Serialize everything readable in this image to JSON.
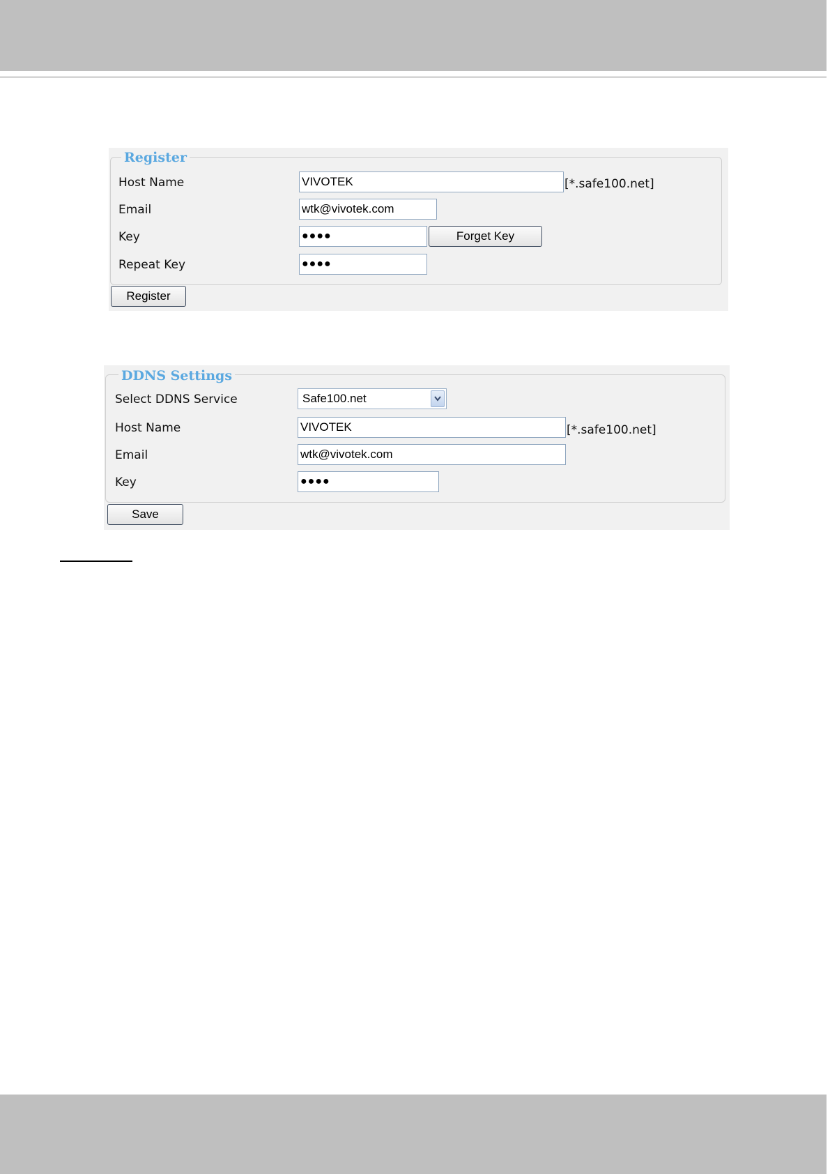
{
  "register": {
    "legend": "Register",
    "host_name_label": "Host Name",
    "host_name_value": "VIVOTEK",
    "host_suffix": "[*.safe100.net]",
    "email_label": "Email",
    "email_value": "wtk@vivotek.com",
    "key_label": "Key",
    "key_value": "●●●●",
    "forget_key_label": "Forget Key",
    "repeat_key_label": "Repeat Key",
    "repeat_key_value": "●●●●",
    "register_button": "Register"
  },
  "ddns": {
    "legend": "DDNS Settings",
    "service_label": "Select DDNS Service",
    "service_selected": "Safe100.net",
    "service_arrow_icon": "chevron-down-icon",
    "host_name_label": "Host Name",
    "host_name_value": "VIVOTEK",
    "host_suffix": "[*.safe100.net]",
    "email_label": "Email",
    "email_value": "wtk@vivotek.com",
    "key_label": "Key",
    "key_value": "●●●●",
    "save_button": "Save"
  },
  "colors": {
    "legend_text": "#5aa8e0",
    "panel_bg": "#f1f1f1",
    "header_band": "#bfbfbf"
  }
}
